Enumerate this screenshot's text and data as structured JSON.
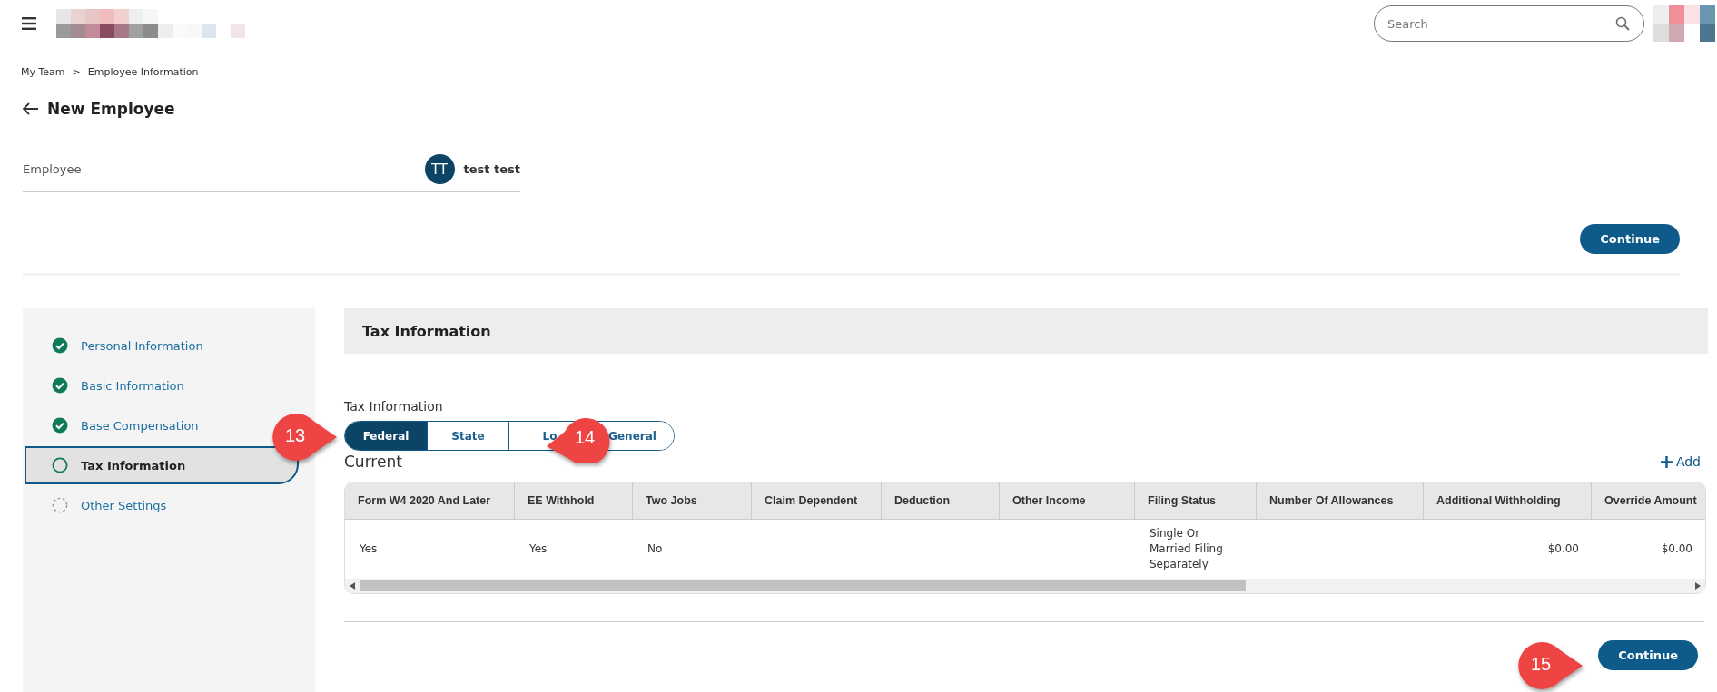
{
  "header": {
    "search": {
      "placeholder": "Search"
    }
  },
  "breadcrumb": [
    {
      "label": "My Team"
    },
    {
      "label": "Employee Information"
    }
  ],
  "breadcrumb_separator": ">",
  "page_title": "New Employee",
  "employee": {
    "label": "Employee",
    "initials": "TT",
    "name": "test test"
  },
  "top_button": "Continue",
  "steps": [
    {
      "label": "Personal Information",
      "kind": "done",
      "selected": false
    },
    {
      "label": "Basic Information",
      "kind": "done",
      "selected": false
    },
    {
      "label": "Base Compensation",
      "kind": "done",
      "selected": false
    },
    {
      "label": "Tax Information",
      "kind": "current",
      "selected": true
    },
    {
      "label": "Other Settings",
      "kind": "pending",
      "selected": false
    }
  ],
  "section_title": "Tax Information",
  "tabs_label": "Tax Information",
  "tabs": [
    {
      "label": "Federal",
      "selected": true
    },
    {
      "label": "State",
      "selected": false
    },
    {
      "label": "Lo",
      "selected": false
    },
    {
      "label": "General",
      "selected": false
    }
  ],
  "current_label": "Current",
  "add_link": "Add",
  "table": {
    "columns": [
      {
        "label": "Form W4 2020 And Later",
        "kind": "text"
      },
      {
        "label": "EE Withhold",
        "kind": "text"
      },
      {
        "label": "Two Jobs",
        "kind": "text"
      },
      {
        "label": "Claim Dependent",
        "kind": "text"
      },
      {
        "label": "Deduction",
        "kind": "text"
      },
      {
        "label": "Other Income",
        "kind": "text"
      },
      {
        "label": "Filing Status",
        "kind": "text"
      },
      {
        "label": "Number Of Allowances",
        "kind": "text"
      },
      {
        "label": "Additional Withholding",
        "kind": "amount"
      },
      {
        "label": "Override Amount",
        "kind": "amount"
      }
    ],
    "rows": [
      {
        "cells": [
          "Yes",
          "Yes",
          "No",
          "",
          "",
          "",
          "Single Or Married Filing Separately",
          "",
          "$0.00",
          "$0.00"
        ]
      }
    ]
  },
  "bottom_button": "Continue",
  "callouts": [
    {
      "number": "13",
      "kind": "right"
    },
    {
      "number": "14",
      "kind": "left"
    },
    {
      "number": "15",
      "kind": "right"
    }
  ]
}
